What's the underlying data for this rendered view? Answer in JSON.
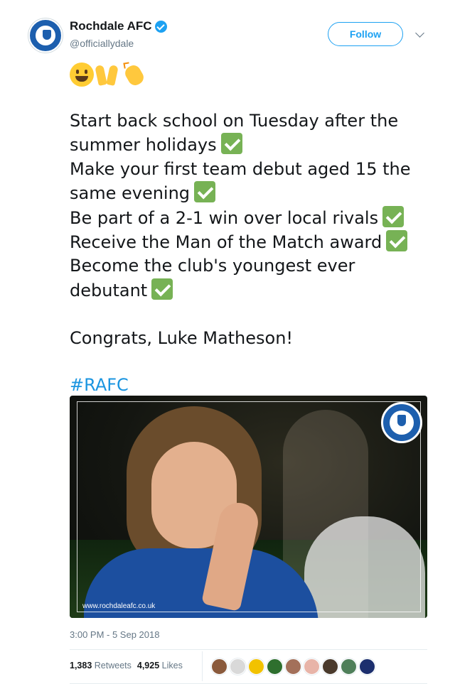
{
  "account": {
    "display_name": "Rochdale AFC",
    "handle": "@officiallydale",
    "verified": true
  },
  "follow_button": {
    "label": "Follow"
  },
  "tweet": {
    "emojis": [
      "grinning-face",
      "raising-hands",
      "clapping-hands"
    ],
    "lines": [
      "Start back school on Tuesday after the",
      "summer holidays",
      "Make your first team debut aged 15 the",
      "same evening",
      "Be part of a 2-1 win over local rivals",
      "Receive the Man of the Match award",
      "Become the club's youngest ever",
      "debutant"
    ],
    "congrats": "Congrats, Luke Matheson!",
    "hashtag": "#RAFC"
  },
  "media": {
    "watermark": "www.rochdaleafc.co.uk"
  },
  "timestamp": "3:00 PM - 5 Sep 2018",
  "stats": {
    "retweets_count": "1,383",
    "retweets_label": "Retweets",
    "likes_count": "4,925",
    "likes_label": "Likes"
  },
  "liker_avatars": [
    {
      "color": "#8a5a3c"
    },
    {
      "color": "#d9d9d9"
    },
    {
      "color": "#f2c200"
    },
    {
      "color": "#2e6f2e"
    },
    {
      "color": "#a3705a"
    },
    {
      "color": "#e8b4a8"
    },
    {
      "color": "#4a3a2c"
    },
    {
      "color": "#4f7f5a"
    },
    {
      "color": "#1c2f6e"
    }
  ],
  "colors": {
    "accent": "#1da1f2",
    "hashtag": "#1b95e0",
    "text": "#14171a",
    "secondary_text": "#657786",
    "check_green": "#77b255",
    "club_blue": "#1d5fae"
  }
}
